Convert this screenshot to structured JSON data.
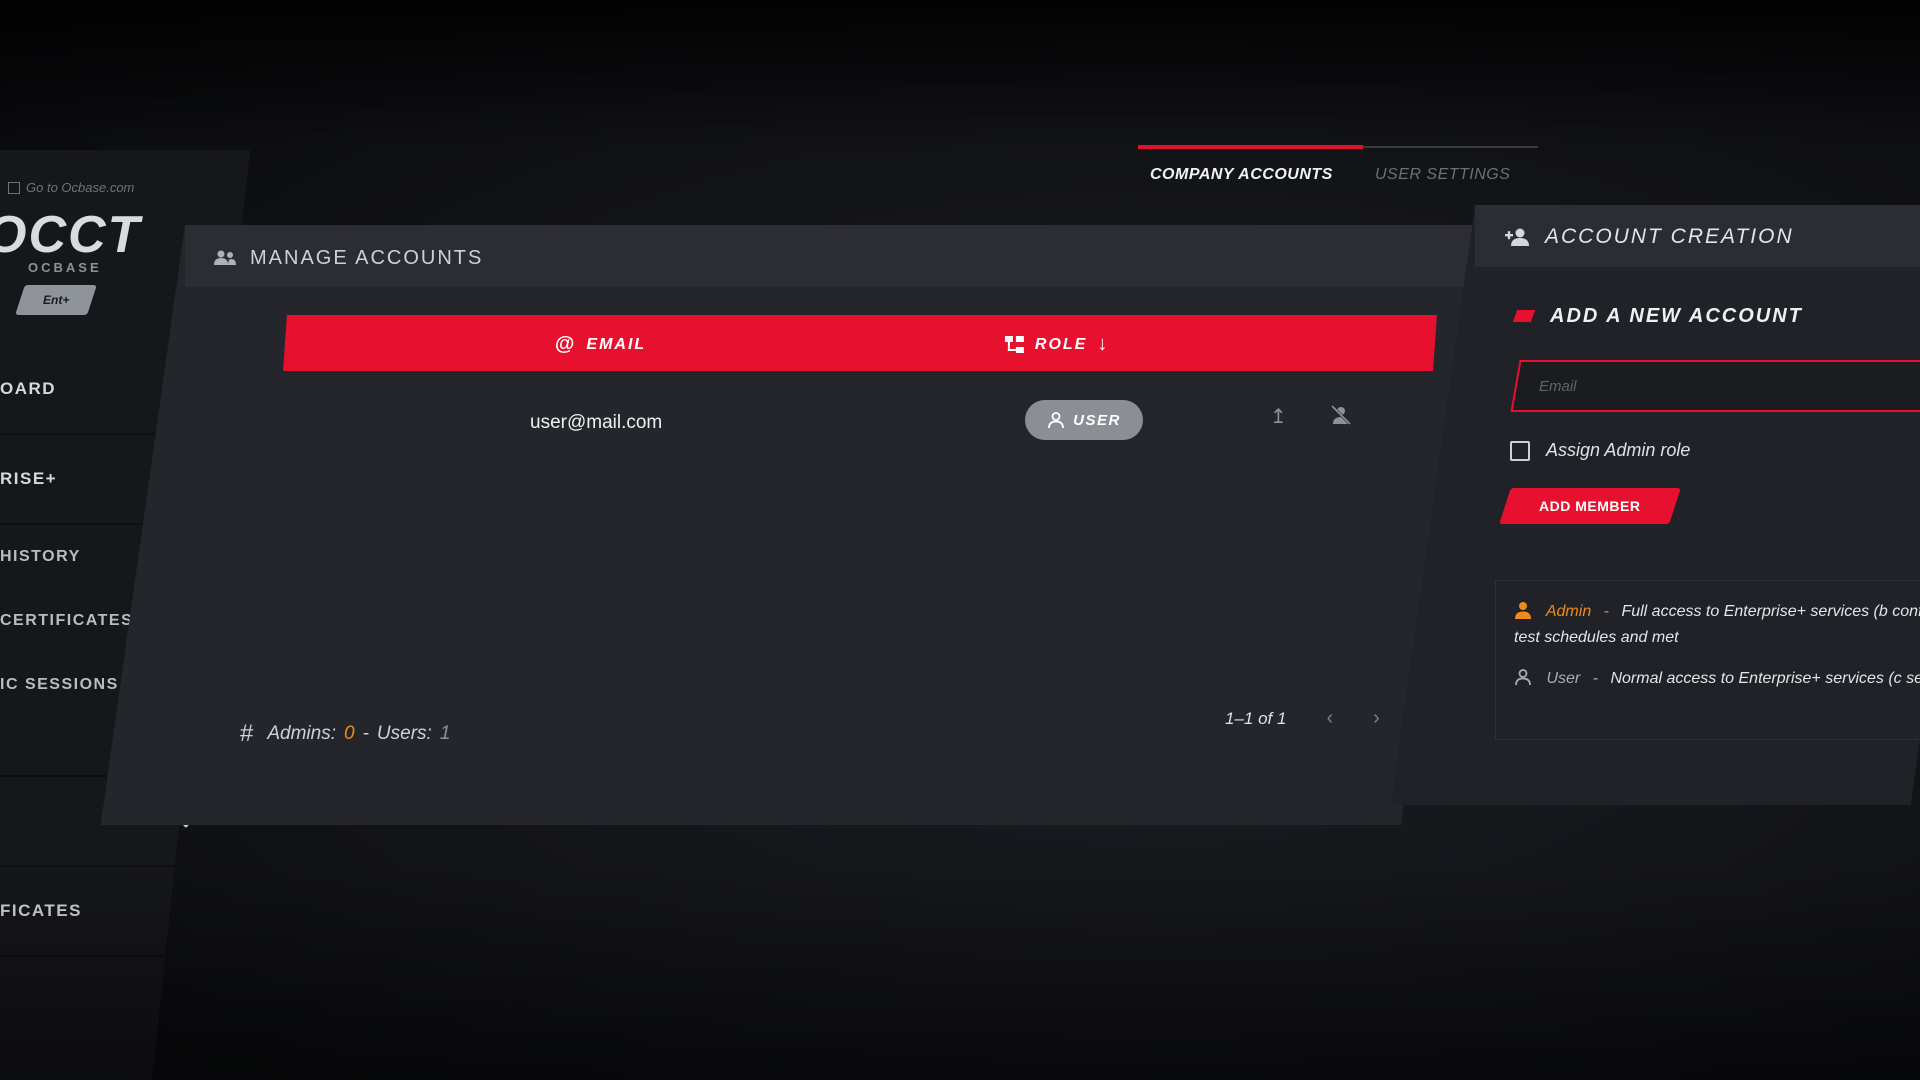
{
  "sidebar": {
    "goto_label": "Go to Ocbase.com",
    "logo_text": "OCCT",
    "logo_sub": "OCBASE",
    "edition_badge": "Ent+",
    "items": [
      {
        "label": "OARD"
      },
      {
        "label": "RISE+"
      },
      {
        "label": "HISTORY"
      },
      {
        "label": "CERTIFICATES"
      },
      {
        "label": "IC SESSIONS"
      },
      {
        "label": "FICATES"
      }
    ]
  },
  "tabs": [
    {
      "label": "COMPANY ACCOUNTS",
      "active": true
    },
    {
      "label": "USER SETTINGS",
      "active": false
    }
  ],
  "manage": {
    "title": "MANAGE ACCOUNTS",
    "columns": {
      "email": "EMAIL",
      "role": "ROLE"
    },
    "rows": [
      {
        "email": "user@mail.com",
        "role": "USER"
      }
    ],
    "footer": {
      "admins_label": "Admins:",
      "admins_count": "0",
      "separator": "-",
      "users_label": "Users:",
      "users_count": "1"
    },
    "pagination": "1–1 of 1"
  },
  "create": {
    "title": "ACCOUNT CREATION",
    "subtitle": "ADD A NEW ACCOUNT",
    "email_placeholder": "Email",
    "assign_admin_label": "Assign Admin role",
    "add_button": "ADD MEMBER",
    "legend": [
      {
        "role": "Admin",
        "sep": "-",
        "desc": "Full access to Enterprise+ services (b config such as test schedules and met"
      },
      {
        "role": "User",
        "sep": "-",
        "desc": "Normal access to Enterprise+ services (c sessions...)."
      }
    ]
  },
  "colors": {
    "accent": "#e8102f",
    "admin": "#f08a1c",
    "panel": "#24262b",
    "background": "#121317"
  },
  "icons": {
    "people": "people-icon",
    "add_person": "add-person-icon",
    "at": "at-icon",
    "hierarchy": "hierarchy-icon",
    "sort_down": "arrow-down-icon",
    "user": "user-icon",
    "promote": "arrow-up-icon",
    "remove_user": "remove-user-icon",
    "prev": "chevron-left-icon",
    "next": "chevron-right-icon",
    "hash": "hash-icon"
  }
}
